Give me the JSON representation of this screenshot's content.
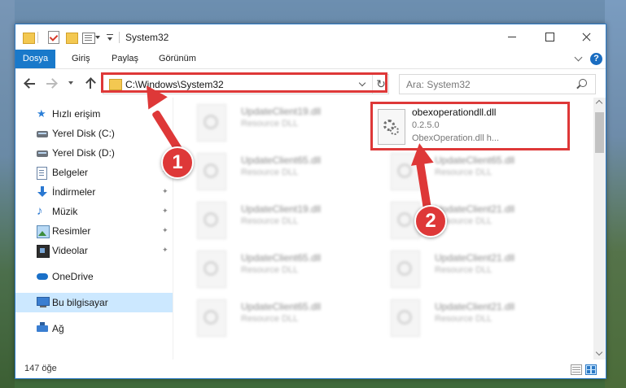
{
  "window": {
    "title": "System32"
  },
  "ribbon": {
    "tabs": [
      "Dosya",
      "Giriş",
      "Paylaş",
      "Görünüm"
    ],
    "help_label": "?"
  },
  "navbar": {
    "address": "C:\\Windows\\System32",
    "refresh_glyph": "↻",
    "search_placeholder": "Ara: System32"
  },
  "sidebar": {
    "items": [
      {
        "label": "Hızlı erişim",
        "icon": "star-icon"
      },
      {
        "label": "Yerel Disk (C:)",
        "icon": "drive-icon"
      },
      {
        "label": "Yerel Disk (D:)",
        "icon": "drive-icon"
      },
      {
        "label": "Belgeler",
        "icon": "documents-icon",
        "pinned": true
      },
      {
        "label": "İndirmeler",
        "icon": "downloads-icon",
        "pinned": true
      },
      {
        "label": "Müzik",
        "icon": "music-icon",
        "pinned": true
      },
      {
        "label": "Resimler",
        "icon": "pictures-icon",
        "pinned": true
      },
      {
        "label": "Videolar",
        "icon": "videos-icon",
        "pinned": true
      },
      {
        "label": "OneDrive",
        "icon": "onedrive-icon"
      },
      {
        "label": "Bu bilgisayar",
        "icon": "computer-icon",
        "selected": true
      },
      {
        "label": "Ağ",
        "icon": "network-icon"
      }
    ],
    "pin_glyph": "📌"
  },
  "files": [
    {
      "name": "UpdateClient19.dll",
      "desc": "Resource DLL"
    },
    {
      "name": "UpdateClient65.dll",
      "desc": "Resource DLL"
    },
    {
      "name": "UpdateClient19.dll",
      "desc": "Resource DLL"
    },
    {
      "name": "UpdateClient65.dll",
      "desc": "Resource DLL"
    },
    {
      "name": "UpdateClient65.dll",
      "desc": "Resource DLL"
    },
    {
      "name": "UpdateClient65.dll",
      "desc": "Resource DLL"
    },
    {
      "name": "UpdateClient21.dll",
      "desc": "Resource DLL"
    },
    {
      "name": "UpdateClient21.dll",
      "desc": "Resource DLL"
    },
    {
      "name": "UpdateClient21.dll",
      "desc": "Resource DLL"
    }
  ],
  "highlighted_file": {
    "name": "obexoperationdll.dll",
    "version": "0.2.5.0",
    "description": "ObexOperation.dll h..."
  },
  "status": {
    "count": "147 öğe"
  },
  "annotations": {
    "step1": "1",
    "step2": "2",
    "color": "#de3838"
  }
}
